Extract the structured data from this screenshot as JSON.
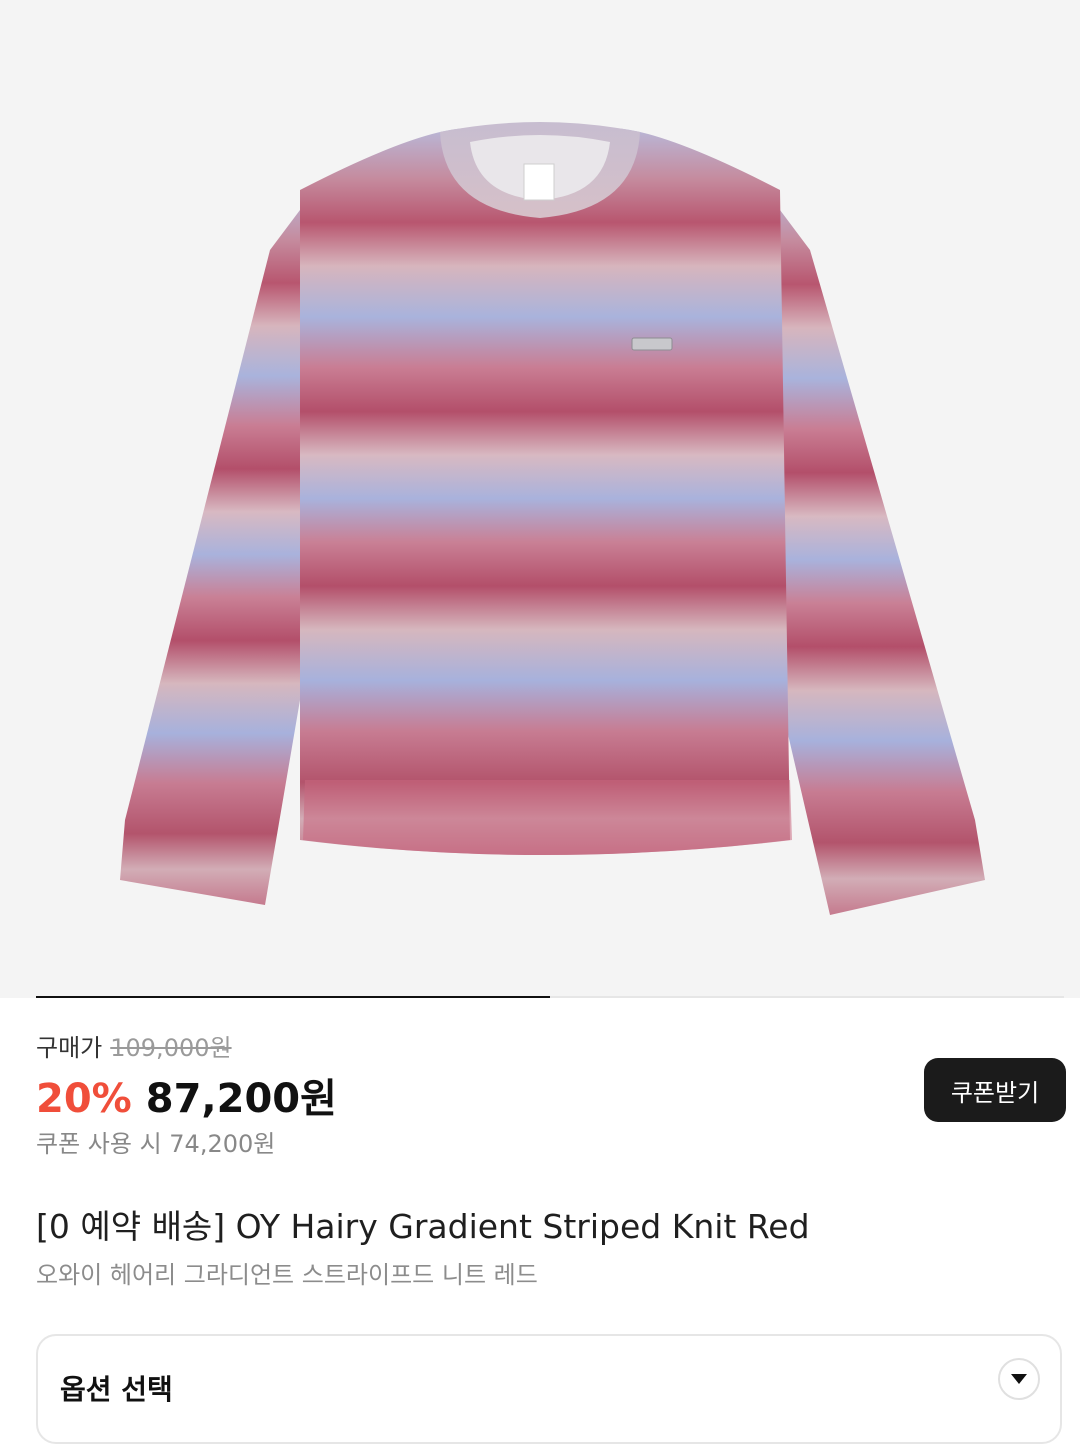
{
  "product_image": {
    "alt_icon": "sweater-image",
    "colors": {
      "rose": "#b8566f",
      "lavender": "#a9b3dc",
      "blush": "#d7b5bd"
    }
  },
  "gallery": {
    "progress_fraction": 0.5
  },
  "price": {
    "label": "구매가",
    "original": "109,000원",
    "discount": "20%",
    "sale": "87,200원",
    "coupon_price": "쿠폰 사용 시 74,200원"
  },
  "coupon_button": {
    "label": "쿠폰받기"
  },
  "product": {
    "title": "[0 예약 배송] OY Hairy Gradient Striped Knit Red",
    "subtitle": "오와이 헤어리 그라디언트 스트라이프드 니트 레드"
  },
  "option": {
    "label": "옵션 선택",
    "icon": "chevron-down-icon"
  },
  "colors": {
    "accent_discount": "#f04e3a",
    "button_bg": "#1b1b1b"
  }
}
